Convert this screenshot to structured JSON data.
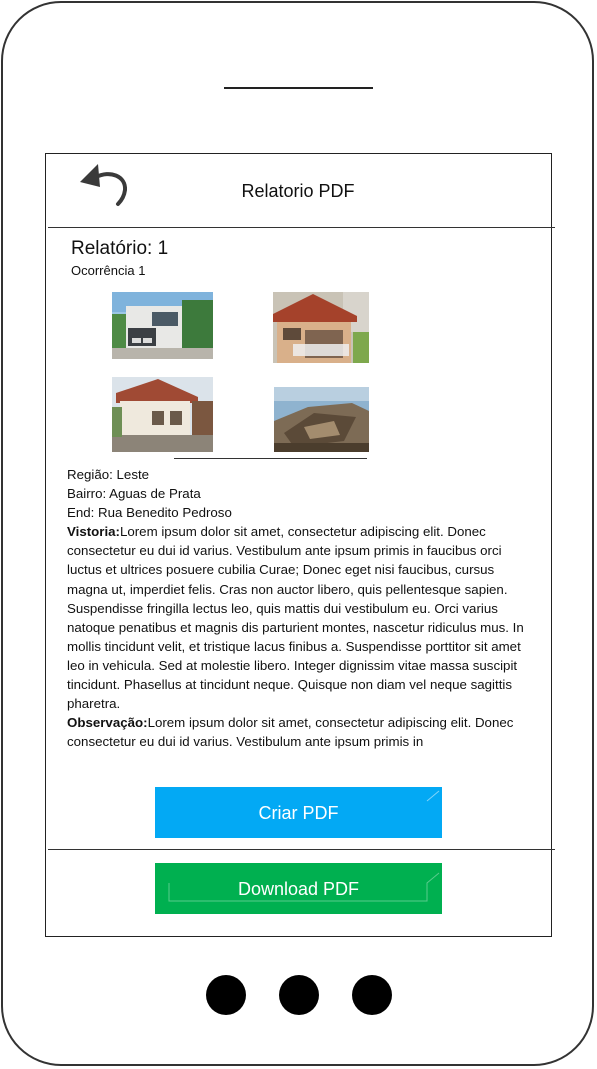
{
  "header": {
    "title": "Relatorio PDF",
    "back_icon": "back-arrow-icon"
  },
  "report": {
    "title": "Relatório: 1",
    "occurrence": "Ocorrência 1",
    "photos": [
      "house-photo",
      "house-photo",
      "house-photo",
      "house-photo"
    ]
  },
  "details": {
    "regiao": "Região: Leste",
    "bairro": "Bairro: Aguas de Prata",
    "end": "End: Rua Benedito Pedroso",
    "vistoria_label": "Vistoria:",
    "vistoria_text": "Lorem ipsum dolor sit amet, consectetur adipiscing elit. Donec consectetur eu dui id varius. Vestibulum ante ipsum primis in faucibus orci luctus et ultrices posuere cubilia Curae; Donec eget nisi faucibus, cursus magna ut, imperdiet felis. Cras non auctor libero, quis pellentesque sapien. Suspendisse fringilla lectus leo, quis mattis dui vestibulum eu. Orci varius natoque penatibus et magnis dis parturient montes, nascetur ridiculus mus. In mollis tincidunt velit, et tristique lacus finibus a. Suspendisse porttitor sit amet leo in vehicula. Sed at molestie libero. Integer dignissim vitae massa suscipit tincidunt. Phasellus at tincidunt neque. Quisque non diam vel neque sagittis pharetra.",
    "observacao_label": "Observação:",
    "observacao_text": "Lorem ipsum dolor sit amet, consectetur adipiscing elit. Donec consectetur eu dui id varius. Vestibulum ante ipsum primis in"
  },
  "buttons": {
    "create_pdf": "Criar PDF",
    "download_pdf": "Download PDF"
  },
  "colors": {
    "create": "#03a9f4",
    "download": "#00b050"
  }
}
